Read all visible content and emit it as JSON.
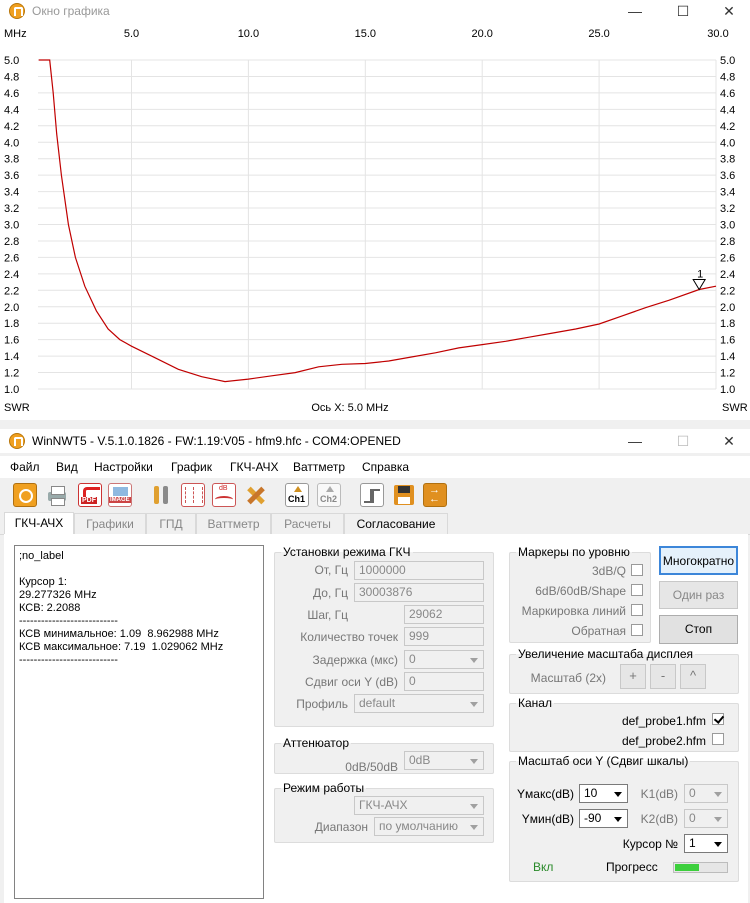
{
  "graph_window": {
    "title": "Окно графика",
    "x_unit": "MHz",
    "y_unit_left": "SWR",
    "y_unit_right": "SWR",
    "x_axis_caption": "Ось X: 5.0 MHz",
    "marker_label": "1",
    "curve_color": "#c00000"
  },
  "chart_data": {
    "type": "line",
    "x_ticks": [
      "5.0",
      "10.0",
      "15.0",
      "20.0",
      "25.0",
      "30.0"
    ],
    "y_ticks": [
      "5.0",
      "4.8",
      "4.6",
      "4.4",
      "4.2",
      "4.0",
      "3.8",
      "3.6",
      "3.4",
      "3.2",
      "3.0",
      "2.8",
      "2.6",
      "2.4",
      "2.2",
      "2.0",
      "1.8",
      "1.6",
      "1.4",
      "1.2",
      "1.0"
    ],
    "xlim": [
      1.0,
      30.0
    ],
    "ylim": [
      1.0,
      5.0
    ],
    "grid": true,
    "series": [
      {
        "x": [
          1.03,
          1.5,
          1.65,
          1.8,
          2.0,
          2.3,
          2.6,
          3.0,
          3.5,
          4.0,
          4.5,
          5.0,
          6.0,
          7.0,
          8.0,
          9.0,
          10.0,
          11.0,
          12.0,
          13.0,
          14.0,
          15.0,
          16.0,
          17.0,
          18.0,
          19.0,
          20.0,
          21.0,
          22.0,
          23.0,
          24.0,
          25.0,
          26.0,
          27.0,
          28.0,
          29.28,
          30.0
        ],
        "y": [
          5.0,
          5.0,
          4.6,
          4.1,
          3.6,
          3.0,
          2.6,
          2.25,
          1.95,
          1.73,
          1.6,
          1.52,
          1.38,
          1.24,
          1.15,
          1.09,
          1.12,
          1.16,
          1.2,
          1.27,
          1.3,
          1.31,
          1.34,
          1.39,
          1.44,
          1.5,
          1.54,
          1.58,
          1.63,
          1.68,
          1.73,
          1.79,
          1.89,
          1.99,
          2.08,
          2.21,
          2.25
        ]
      }
    ],
    "marker": {
      "x": 29.28,
      "y": 2.21
    }
  },
  "app": {
    "title": "WinNWT5 - V.5.1.0.1826 - FW:1.19:V05 - hfm9.hfc - COM4:OPENED"
  },
  "menu": [
    "Файл",
    "Вид",
    "Настройки",
    "График",
    "ГКЧ-АЧХ",
    "Ваттметр",
    "Справка"
  ],
  "toolbar_icons": [
    "power-icon",
    "printer-icon",
    "pdf-icon",
    "image-icon",
    "tools-icon",
    "grid-icon",
    "db-chart-icon",
    "calibrate-icon",
    "channel1-icon",
    "channel2-icon",
    "sweep-icon",
    "save-icon",
    "swap-icon"
  ],
  "toolbar_text": {
    "pdf": "PDF",
    "image": "IMAGE",
    "db": "dB",
    "ch1": "Ch1",
    "ch2": "Ch2"
  },
  "tabs": [
    "ГКЧ-АЧХ",
    "Графики",
    "ГПД",
    "Ваттметр",
    "Расчеты",
    "Согласование"
  ],
  "info_panel": [
    ";no_label",
    "",
    "Курсор 1:",
    "29.277326 MHz",
    "КСВ: 2.2088",
    "---------------------------",
    "КСВ минимальное: 1.09  8.962988 MHz",
    "КСВ максимальное: 7.19  1.029062 MHz",
    "---------------------------"
  ],
  "sweep_settings": {
    "title": "Установки режима ГКЧ",
    "from_label": "От, Гц",
    "from_value": "1000000",
    "to_label": "До, Гц",
    "to_value": "30003876",
    "step_label": "Шаг, Гц",
    "step_value": "29062",
    "points_label": "Количество точек",
    "points_value": "999",
    "delay_label": "Задержка (мкс)",
    "delay_value": "0",
    "yshift_label": "Сдвиг оси Y (dB)",
    "yshift_value": "0",
    "profile_label": "Профиль",
    "profile_value": "default"
  },
  "attenuator": {
    "title": "Аттенюатор",
    "label": "0dB/50dB",
    "value": "0dB"
  },
  "mode": {
    "title": "Режим работы",
    "mode_value": "ГКЧ-АЧХ",
    "range_label": "Диапазон",
    "range_value": "по умолчанию"
  },
  "markers": {
    "title": "Маркеры по уровню",
    "items": [
      {
        "label": "3dB/Q",
        "checked": false
      },
      {
        "label": "6dB/60dB/Shape",
        "checked": false
      },
      {
        "label": "Маркировка линий",
        "checked": false
      },
      {
        "label": "Обратная",
        "checked": false
      }
    ]
  },
  "buttons": {
    "multi": "Многократно",
    "once": "Один раз",
    "stop": "Стоп"
  },
  "zoom": {
    "title": "Увеличение масштаба дисплея",
    "label": "Масштаб (2x)",
    "plus": "+",
    "minus": "-",
    "up": "^"
  },
  "channel": {
    "title": "Канал",
    "probe1": "def_probe1.hfm",
    "probe1_checked": true,
    "probe2": "def_probe2.hfm",
    "probe2_checked": false
  },
  "yscale": {
    "title": "Масштаб оси Y (Сдвиг шкалы)",
    "ymax_label": "Yмакс(dB)",
    "ymax_value": "10",
    "ymin_label": "Yмин(dB)",
    "ymin_value": "-90",
    "k1_label": "K1(dB)",
    "k1_value": "0",
    "k2_label": "K2(dB)",
    "k2_value": "0",
    "cursor_label": "Курсор №",
    "cursor_value": "1",
    "on_label": "Вкл",
    "on_color": "#2a8a2a",
    "progress_label": "Прогресс",
    "progress_fraction": 0.45,
    "progress_color": "#3ccf3c"
  }
}
